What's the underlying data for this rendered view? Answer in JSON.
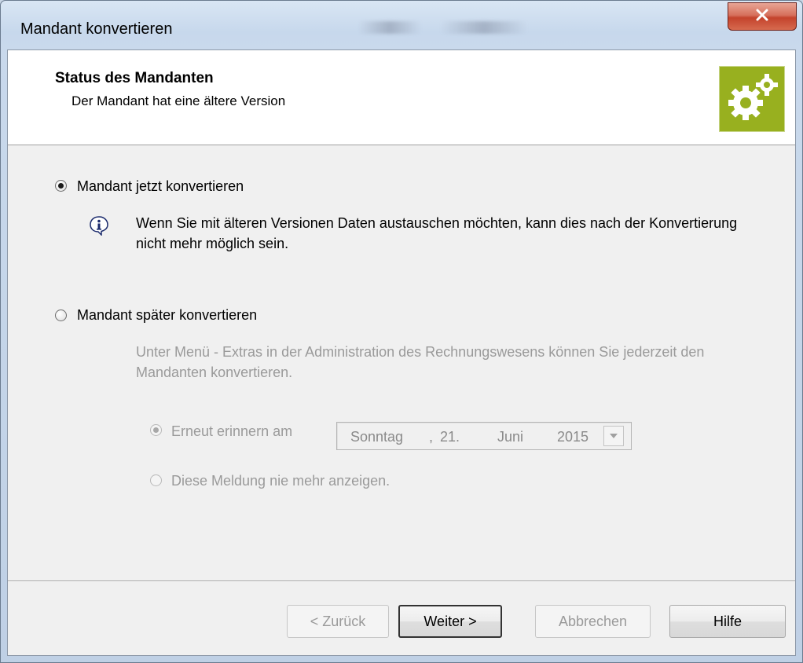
{
  "window": {
    "title": "Mandant konvertieren",
    "close_icon": "close-x-icon"
  },
  "header": {
    "title": "Status des Mandanten",
    "subtitle": "Der Mandant hat eine ältere Version",
    "icon": "gears-icon",
    "icon_bg": "#98b01f"
  },
  "options": {
    "convert_now": {
      "label": "Mandant jetzt konvertieren",
      "checked": true,
      "info_icon": "info-icon",
      "info_text": "Wenn Sie mit älteren Versionen Daten austauschen möchten, kann dies nach der Konvertierung nicht mehr möglich sein."
    },
    "convert_later": {
      "label": "Mandant später konvertieren",
      "checked": false,
      "description": "Unter Menü - Extras in der Administration des Rechnungswesens können Sie jederzeit den Mandanten konvertieren.",
      "remind": {
        "label": "Erneut erinnern am",
        "checked": true,
        "enabled": false,
        "date": {
          "weekday": "Sonntag",
          "separator": ",",
          "day": "21.",
          "month": "Juni",
          "year": "2015"
        }
      },
      "never_show": {
        "label": "Diese Meldung nie mehr anzeigen.",
        "checked": false,
        "enabled": false
      }
    }
  },
  "buttons": {
    "back": "< Zurück",
    "next": "Weiter >",
    "cancel": "Abbrechen",
    "help": "Hilfe"
  }
}
